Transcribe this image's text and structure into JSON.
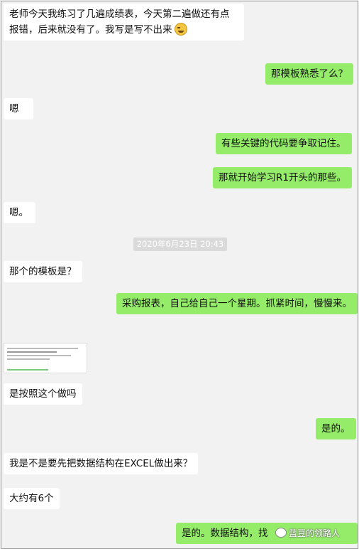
{
  "messages": [
    {
      "from": "other",
      "text": "老师今天我练习了几遍成绩表，今天第二遍做还有点报错，后来就没有了。我写是写不出来"
    },
    {
      "from": "me",
      "text": "那模板熟悉了么？"
    },
    {
      "from": "other",
      "text": "嗯"
    },
    {
      "from": "me",
      "text": "有些关键的代码要争取记住。"
    },
    {
      "from": "me",
      "text": "那就开始学习R1开头的那些。"
    },
    {
      "from": "other",
      "text": "嗯。"
    },
    {
      "from": "other",
      "text": "那个的模板是？"
    },
    {
      "from": "me",
      "text": "采购报表，自己给自己一个星期。抓紧时间，慢慢来。"
    },
    {
      "from": "other",
      "text": "是按照这个做吗"
    },
    {
      "from": "me",
      "text": "是的。"
    },
    {
      "from": "other",
      "text": "我是不是要先把数据结构在EXCEL做出来？"
    },
    {
      "from": "other",
      "text": "大约有6个"
    },
    {
      "from": "me",
      "text": "是的。数据结构，找"
    }
  ],
  "timestamp": "2020年6月23日 20:43",
  "emoji_icon": "laughing-emoji-icon",
  "watermark": "蓝豆的领路人",
  "colors": {
    "incoming": "#ffffff",
    "outgoing": "#95ec69",
    "background": "#f2f2f2",
    "timestamp_bg": "#dadada"
  }
}
